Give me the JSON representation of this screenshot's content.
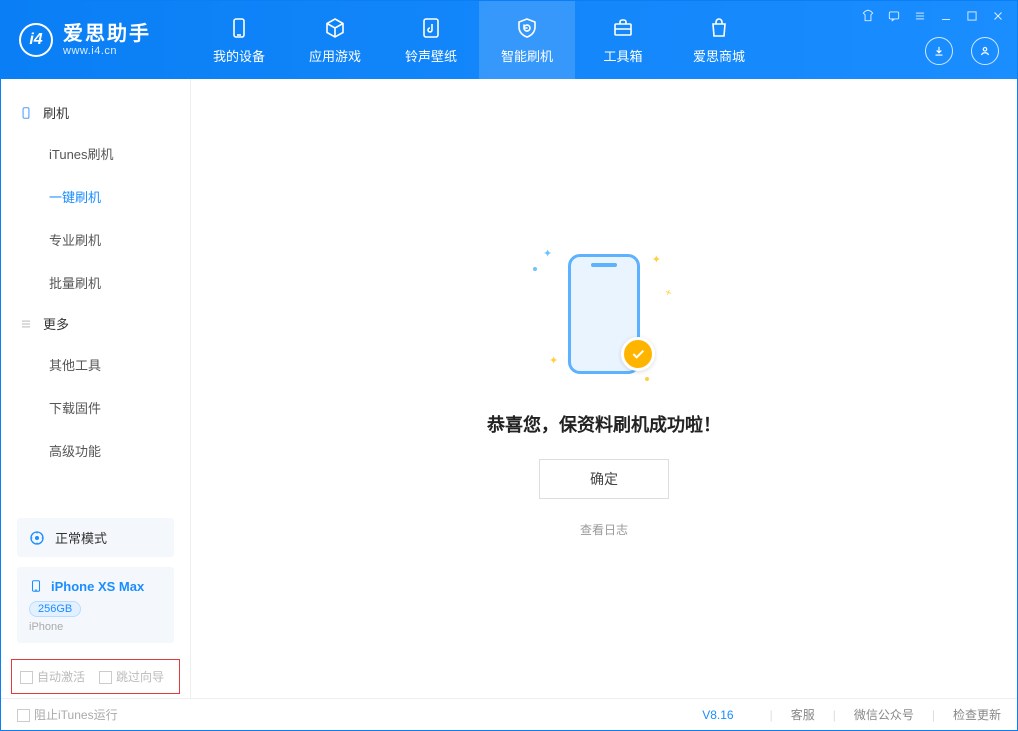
{
  "app": {
    "name_cn": "爱思助手",
    "name_en": "www.i4.cn"
  },
  "nav": [
    {
      "key": "device",
      "label": "我的设备"
    },
    {
      "key": "apps",
      "label": "应用游戏"
    },
    {
      "key": "ring",
      "label": "铃声壁纸"
    },
    {
      "key": "flash",
      "label": "智能刷机",
      "active": true
    },
    {
      "key": "toolbox",
      "label": "工具箱"
    },
    {
      "key": "store",
      "label": "爱思商城"
    }
  ],
  "sidebar": {
    "flash_header": "刷机",
    "flash_items": [
      {
        "key": "itunes",
        "label": "iTunes刷机"
      },
      {
        "key": "onekey",
        "label": "一键刷机",
        "active": true
      },
      {
        "key": "pro",
        "label": "专业刷机"
      },
      {
        "key": "batch",
        "label": "批量刷机"
      }
    ],
    "more_header": "更多",
    "more_items": [
      {
        "key": "other",
        "label": "其他工具"
      },
      {
        "key": "firmware",
        "label": "下载固件"
      },
      {
        "key": "advanced",
        "label": "高级功能"
      }
    ]
  },
  "device": {
    "mode": "正常模式",
    "name": "iPhone XS Max",
    "capacity": "256GB",
    "type": "iPhone"
  },
  "options": {
    "auto_activate": "自动激活",
    "skip_guide": "跳过向导"
  },
  "main": {
    "success": "恭喜您，保资料刷机成功啦！",
    "ok": "确定",
    "view_log": "查看日志"
  },
  "footer": {
    "block_itunes": "阻止iTunes运行",
    "version": "V8.16",
    "links": [
      "客服",
      "微信公众号",
      "检查更新"
    ]
  }
}
